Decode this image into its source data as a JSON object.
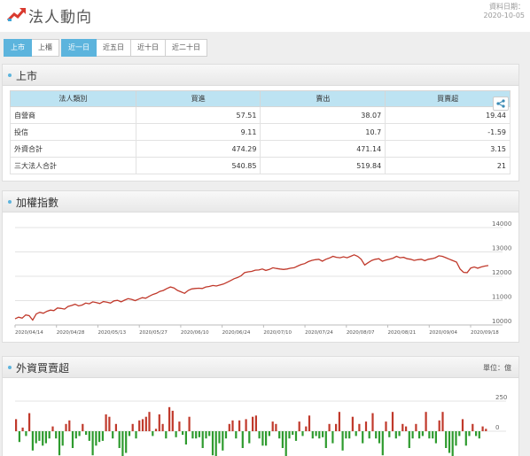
{
  "header": {
    "title": "法人動向",
    "date_label": "資料日期：",
    "date_value": "2020-10-05",
    "icon": "trend-up-icon"
  },
  "buttons": {
    "market": [
      {
        "label": "上市",
        "active": true
      },
      {
        "label": "上櫃",
        "active": false
      }
    ],
    "period": [
      {
        "label": "近一日",
        "active": true
      },
      {
        "label": "近五日",
        "active": false
      },
      {
        "label": "近十日",
        "active": false
      },
      {
        "label": "近二十日",
        "active": false
      }
    ]
  },
  "table_panel": {
    "title": "上市",
    "columns": [
      "法人類別",
      "買進",
      "賣出",
      "買賣超"
    ],
    "rows": [
      [
        "自營商",
        "57.51",
        "38.07",
        "19.44"
      ],
      [
        "投信",
        "9.11",
        "10.7",
        "-1.59"
      ],
      [
        "外資合計",
        "474.29",
        "471.14",
        "3.15"
      ],
      [
        "三大法人合計",
        "540.85",
        "519.84",
        "21"
      ]
    ],
    "share_icon": "share-icon"
  },
  "index_panel": {
    "title": "加權指數"
  },
  "foreign_panel": {
    "title": "外資買賣超",
    "unit_label": "單位：億"
  },
  "colors": {
    "accent": "#5cb4dd",
    "line": "#c0392b",
    "buy": "#c0392b",
    "sell": "#2e9b2e",
    "table_header": "#bde3f2"
  },
  "chart_data": [
    {
      "type": "line",
      "title": "加權指數",
      "xlabel": "",
      "ylabel": "",
      "ylim": [
        10000,
        14000
      ],
      "yticks": [
        10000,
        11000,
        12000,
        13000,
        14000
      ],
      "xticks": [
        "2020/04/14",
        "2020/04/28",
        "2020/05/13",
        "2020/05/27",
        "2020/06/10",
        "2020/06/24",
        "2020/07/10",
        "2020/07/24",
        "2020/08/07",
        "2020/08/21",
        "2020/09/04",
        "2020/09/18"
      ],
      "grid": true,
      "series": [
        {
          "values": [
            10250,
            10320,
            10280,
            10410,
            10380,
            10200,
            10450,
            10520,
            10480,
            10560,
            10610,
            10590,
            10700,
            10680,
            10650,
            10760,
            10800,
            10850,
            10780,
            10820,
            10900,
            10870,
            10950,
            10920,
            10880,
            10960,
            10940,
            10900,
            10990,
            11010,
            10950,
            11020,
            11080,
            11050,
            11000,
            11060,
            11120,
            11100,
            11180,
            11250,
            11300,
            11380,
            11420,
            11500,
            11560,
            11520,
            11420,
            11360,
            11300,
            11420,
            11480,
            11500,
            11510,
            11500,
            11560,
            11580,
            11620,
            11600,
            11640,
            11680,
            11750,
            11820,
            11900,
            11950,
            12020,
            12150,
            12180,
            12200,
            12250,
            12260,
            12300,
            12240,
            12280,
            12350,
            12320,
            12300,
            12280,
            12300,
            12330,
            12350,
            12420,
            12480,
            12520,
            12600,
            12650,
            12680,
            12700,
            12620,
            12700,
            12750,
            12820,
            12780,
            12760,
            12800,
            12760,
            12820,
            12880,
            12820,
            12700,
            12460,
            12560,
            12650,
            12700,
            12720,
            12620,
            12660,
            12700,
            12740,
            12820,
            12760,
            12780,
            12720,
            12700,
            12650,
            12680,
            12700,
            12640,
            12700,
            12720,
            12760,
            12840,
            12820,
            12760,
            12700,
            12640,
            12580,
            12300,
            12160,
            12150,
            12340,
            12380,
            12330,
            12380,
            12420,
            12440
          ]
        }
      ]
    },
    {
      "type": "bar",
      "title": "外資買賣超",
      "xlabel": "",
      "ylabel": "單位：億",
      "yticks": [
        250,
        0
      ],
      "grid": true,
      "series": [
        {
          "values": [
            100,
            -90,
            30,
            -40,
            150,
            -160,
            -100,
            -80,
            -120,
            -100,
            -60,
            40,
            -60,
            -200,
            -120,
            60,
            90,
            -140,
            -60,
            -40,
            60,
            -30,
            -80,
            -200,
            -120,
            -90,
            -80,
            140,
            120,
            -60,
            60,
            -140,
            -220,
            -180,
            -40,
            60,
            -60,
            90,
            100,
            120,
            160,
            -40,
            20,
            140,
            60,
            -60,
            200,
            170,
            -50,
            80,
            -30,
            -110,
            120,
            -60,
            -60,
            -50,
            -140,
            -60,
            -40,
            -200,
            -240,
            -100,
            -160,
            -60,
            60,
            90,
            -60,
            90,
            -140,
            100,
            -100,
            120,
            130,
            -60,
            -120,
            -120,
            -40,
            80,
            60,
            -60,
            -140,
            -240,
            -60,
            -30,
            -80,
            80,
            -40,
            40,
            130,
            -60,
            -40,
            -60,
            -50,
            -140,
            60,
            -100,
            60,
            160,
            -160,
            -60,
            -60,
            120,
            -40,
            60,
            -100,
            80,
            -60,
            150,
            -60,
            -100,
            -200,
            80,
            -50,
            160,
            -60,
            -40,
            60,
            40,
            -140,
            -60,
            60,
            -60,
            -40,
            160,
            -60,
            -60,
            -100,
            90,
            160,
            -140,
            -180,
            -240,
            -120,
            -40,
            100,
            -120,
            -40,
            60,
            -40,
            -60,
            40,
            20
          ]
        }
      ]
    }
  ]
}
